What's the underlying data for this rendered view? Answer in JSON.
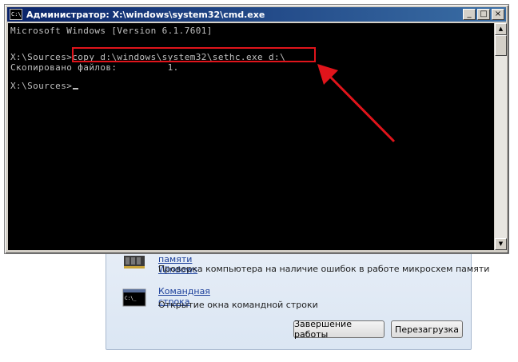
{
  "recovery": {
    "items": [
      {
        "link": "Диагностика памяти Windows",
        "desc": "Проверка компьютера на наличие ошибок в работе микросхем памяти"
      },
      {
        "link": "Командная строка",
        "desc": "Открытие окна командной строки"
      }
    ],
    "shutdown_label": "Завершение работы",
    "restart_label": "Перезагрузка"
  },
  "cmd": {
    "icon_text": "C:\\.",
    "title": "Администратор: X:\\windows\\system32\\cmd.exe",
    "controls": {
      "minimize": "_",
      "maximize": "□",
      "close": "×"
    },
    "lines": [
      "Microsoft Windows [Version 6.1.7601]",
      "",
      "X:\\Sources>copy d:\\windows\\system32\\sethc.exe d:\\",
      "Скопировано файлов:         1.",
      "",
      "X:\\Sources>"
    ]
  },
  "colors": {
    "annotation": "#e0141b",
    "console_bg": "#000000",
    "console_fg": "#c0c0c0"
  }
}
